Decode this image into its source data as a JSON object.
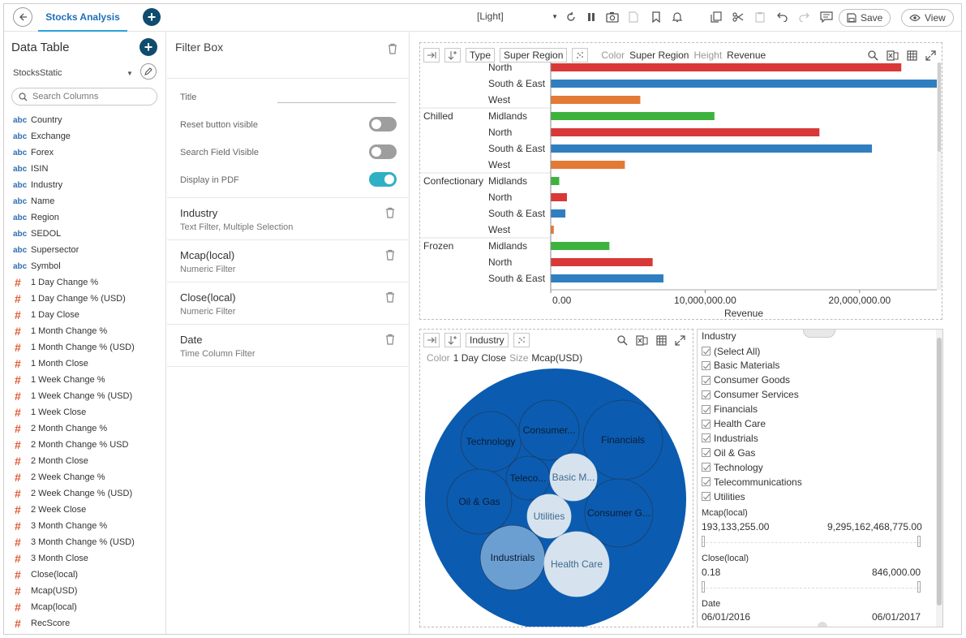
{
  "topbar": {
    "tab_label": "Stocks Analysis",
    "theme": "[Light]",
    "save_label": "Save",
    "view_label": "View"
  },
  "data_table": {
    "title": "Data Table",
    "source": "StocksStatic",
    "search_placeholder": "Search Columns",
    "columns": [
      {
        "type": "abc",
        "name": "Country"
      },
      {
        "type": "abc",
        "name": "Exchange"
      },
      {
        "type": "abc",
        "name": "Forex"
      },
      {
        "type": "abc",
        "name": "ISIN"
      },
      {
        "type": "abc",
        "name": "Industry"
      },
      {
        "type": "abc",
        "name": "Name"
      },
      {
        "type": "abc",
        "name": "Region"
      },
      {
        "type": "abc",
        "name": "SEDOL"
      },
      {
        "type": "abc",
        "name": "Supersector"
      },
      {
        "type": "abc",
        "name": "Symbol"
      },
      {
        "type": "#",
        "name": "1 Day Change %"
      },
      {
        "type": "#",
        "name": "1 Day Change % (USD)"
      },
      {
        "type": "#",
        "name": "1 Day Close"
      },
      {
        "type": "#",
        "name": "1 Month Change %"
      },
      {
        "type": "#",
        "name": "1 Month Change % (USD)"
      },
      {
        "type": "#",
        "name": "1 Month Close"
      },
      {
        "type": "#",
        "name": "1 Week Change %"
      },
      {
        "type": "#",
        "name": "1 Week Change % (USD)"
      },
      {
        "type": "#",
        "name": "1 Week Close"
      },
      {
        "type": "#",
        "name": "2 Month Change %"
      },
      {
        "type": "#",
        "name": "2 Month Change % USD"
      },
      {
        "type": "#",
        "name": "2 Month Close"
      },
      {
        "type": "#",
        "name": "2 Week Change %"
      },
      {
        "type": "#",
        "name": "2 Week Change % (USD)"
      },
      {
        "type": "#",
        "name": "2 Week Close"
      },
      {
        "type": "#",
        "name": "3 Month Change %"
      },
      {
        "type": "#",
        "name": "3 Month Change % (USD)"
      },
      {
        "type": "#",
        "name": "3 Month Close"
      },
      {
        "type": "#",
        "name": "Close(local)"
      },
      {
        "type": "#",
        "name": "Mcap(USD)"
      },
      {
        "type": "#",
        "name": "Mcap(local)"
      },
      {
        "type": "#",
        "name": "RecScore"
      }
    ]
  },
  "filter_box": {
    "title": "Filter Box",
    "settings": {
      "title_label": "Title",
      "reset_label": "Reset button visible",
      "reset_on": false,
      "search_label": "Search Field Visible",
      "search_on": false,
      "pdf_label": "Display in PDF",
      "pdf_on": true
    },
    "filters": [
      {
        "name": "Industry",
        "desc": "Text Filter, Multiple Selection"
      },
      {
        "name": "Mcap(local)",
        "desc": "Numeric Filter"
      },
      {
        "name": "Close(local)",
        "desc": "Numeric Filter"
      },
      {
        "name": "Date",
        "desc": "Time Column Filter"
      }
    ]
  },
  "bar_panel": {
    "type_label": "Type",
    "type_value": "Super Region",
    "color_label": "Color",
    "color_value": "Super Region",
    "height_label": "Height",
    "height_value": "Revenue"
  },
  "chart_data": {
    "type": "bar",
    "orientation": "horizontal",
    "xlabel": "Revenue",
    "xlim": [
      0,
      25000000
    ],
    "xticks": [
      "0.00",
      "10,000,000.00",
      "20,000,000.00"
    ],
    "grid": false,
    "rows": [
      {
        "group": "",
        "region": "North",
        "value": 22700000,
        "color": "#d93838"
      },
      {
        "group": "",
        "region": "South & East",
        "value": 25000000,
        "color": "#2f7fc0"
      },
      {
        "group": "",
        "region": "West",
        "value": 5800000,
        "color": "#e37a35"
      },
      {
        "group": "Chilled",
        "region": "Midlands",
        "value": 10600000,
        "color": "#3db33d"
      },
      {
        "group": "",
        "region": "North",
        "value": 17400000,
        "color": "#d93838"
      },
      {
        "group": "",
        "region": "South & East",
        "value": 20800000,
        "color": "#2f7fc0"
      },
      {
        "group": "",
        "region": "West",
        "value": 4800000,
        "color": "#e37a35"
      },
      {
        "group": "Confectionary",
        "region": "Midlands",
        "value": 550000,
        "color": "#3db33d"
      },
      {
        "group": "",
        "region": "North",
        "value": 1050000,
        "color": "#d93838"
      },
      {
        "group": "",
        "region": "South & East",
        "value": 950000,
        "color": "#2f7fc0"
      },
      {
        "group": "",
        "region": "West",
        "value": 200000,
        "color": "#e37a35"
      },
      {
        "group": "Frozen",
        "region": "Midlands",
        "value": 3800000,
        "color": "#3db33d"
      },
      {
        "group": "",
        "region": "North",
        "value": 6600000,
        "color": "#d93838"
      },
      {
        "group": "",
        "region": "South & East",
        "value": 7300000,
        "color": "#2f7fc0"
      },
      {
        "group": "",
        "region": "West",
        "value": null,
        "color": "#e37a35"
      }
    ]
  },
  "bubble_panel": {
    "type_value": "Industry",
    "color_label": "Color",
    "color_value": "1 Day Close",
    "size_label": "Size",
    "size_value": "Mcap(USD)",
    "outer_color": "#0b5cb0",
    "bubbles": [
      {
        "label": "Technology",
        "fill": "#0b5cb0"
      },
      {
        "label": "Consumer...",
        "fill": "#0b5cb0"
      },
      {
        "label": "Financials",
        "fill": "#0b5cb0"
      },
      {
        "label": "Teleco...",
        "fill": "#0b5cb0"
      },
      {
        "label": "Basic M...",
        "fill": "#d6e3ee"
      },
      {
        "label": "Oil & Gas",
        "fill": "#0b5cb0"
      },
      {
        "label": "Utilities",
        "fill": "#d6e3ee"
      },
      {
        "label": "Consumer G...",
        "fill": "#0b5cb0"
      },
      {
        "label": "Industrials",
        "fill": "#6b9fd1"
      },
      {
        "label": "Health Care",
        "fill": "#d6e3ee"
      }
    ]
  },
  "filter_panel": {
    "industry_label": "Industry",
    "industry_options": [
      "(Select All)",
      "Basic Materials",
      "Consumer Goods",
      "Consumer Services",
      "Financials",
      "Health Care",
      "Industrials",
      "Oil & Gas",
      "Technology",
      "Telecommunications",
      "Utilities"
    ],
    "mcap_label": "Mcap(local)",
    "mcap_min": "193,133,255.00",
    "mcap_max": "9,295,162,468,775.00",
    "close_label": "Close(local)",
    "close_min": "0.18",
    "close_max": "846,000.00",
    "date_label": "Date",
    "date_min": "06/01/2016",
    "date_max": "06/01/2017"
  }
}
